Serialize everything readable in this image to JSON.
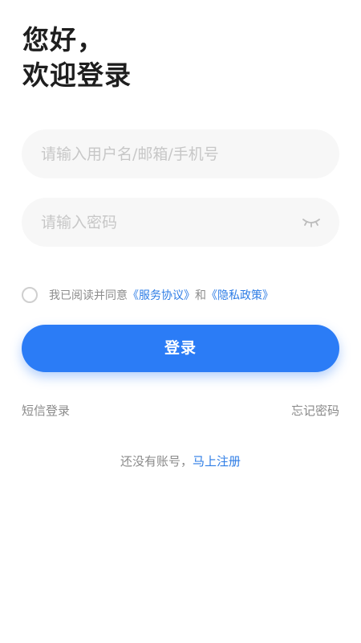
{
  "greeting": {
    "line1": "您好，",
    "line2": "欢迎登录"
  },
  "form": {
    "username_placeholder": "请输入用户名/邮箱/手机号",
    "username_value": "",
    "password_placeholder": "请输入密码",
    "password_value": "",
    "password_toggle_icon": "eye-closed-icon"
  },
  "agreement": {
    "checked": false,
    "prefix": "我已阅读并同意",
    "service_link": "《服务协议》",
    "connector": "和",
    "privacy_link": "《隐私政策》"
  },
  "login_button": "登录",
  "links": {
    "sms_login": "短信登录",
    "forgot_password": "忘记密码"
  },
  "register": {
    "prompt": "还没有账号，",
    "link": "马上注册"
  },
  "colors": {
    "accent": "#2b7cf6",
    "link": "#2e7de6",
    "field_bg": "#f7f7f7",
    "muted_text": "#8a8a8a"
  }
}
